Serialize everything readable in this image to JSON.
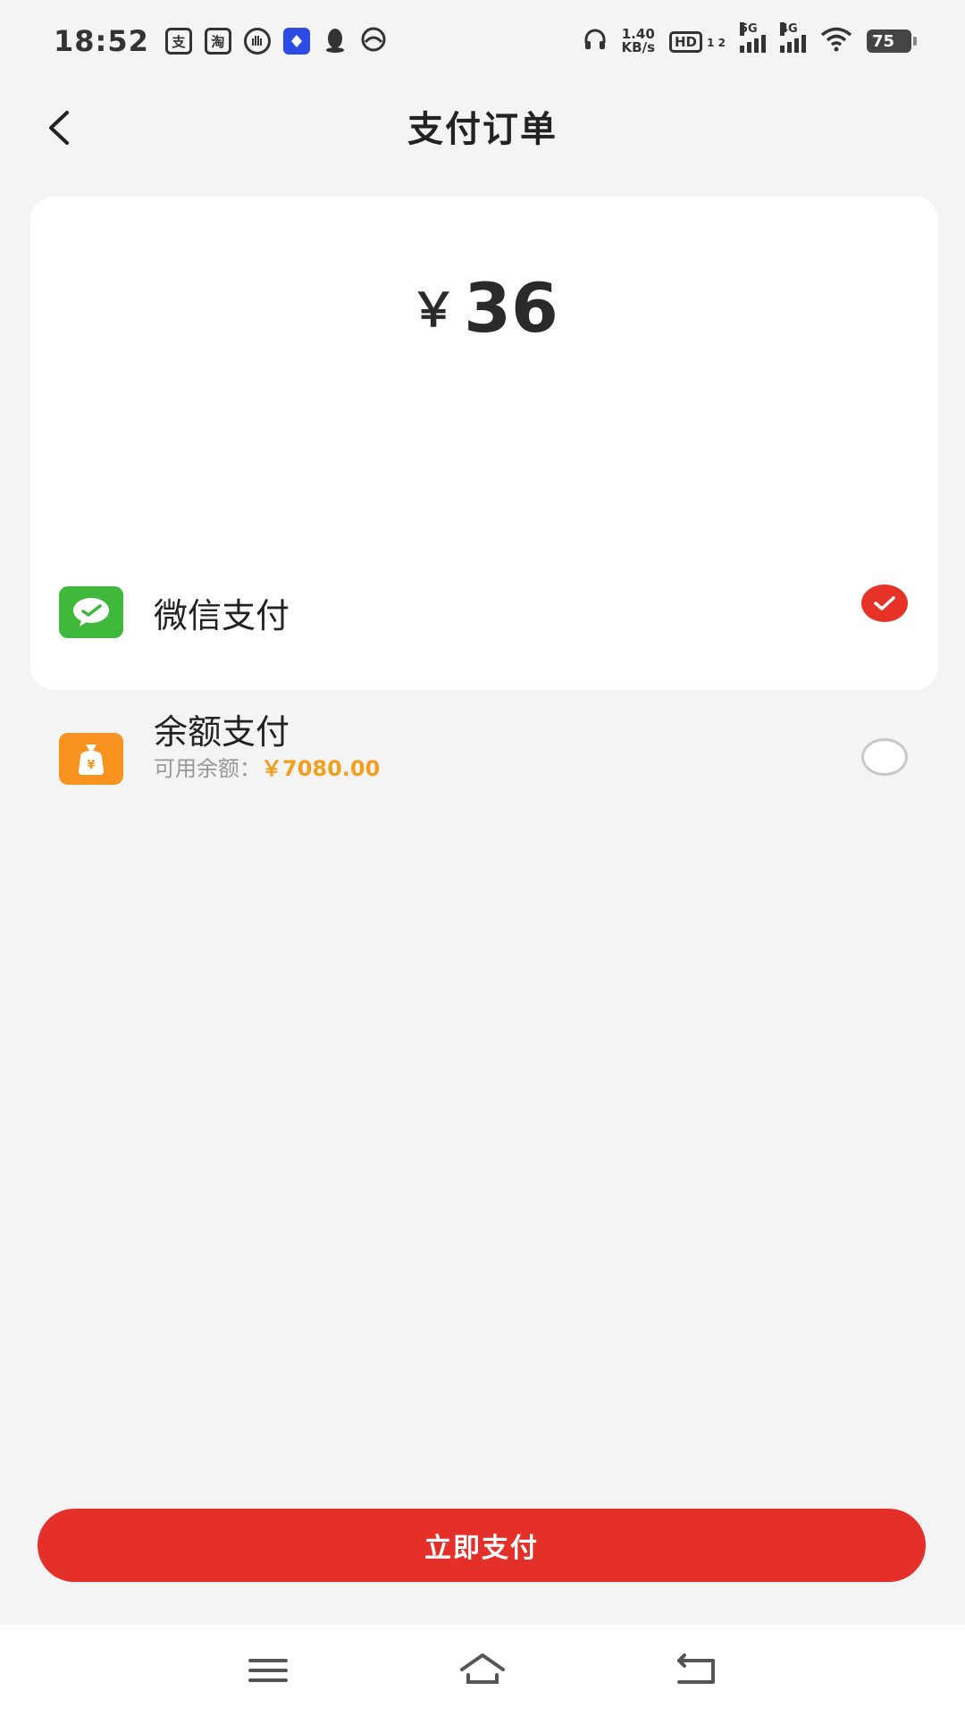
{
  "status_bar": {
    "time": "18:52",
    "app_icons": [
      "支",
      "淘"
    ],
    "net_speed_value": "1.40",
    "net_speed_unit": "KB/s",
    "hd_label": "HD",
    "hd_sub": "1 2",
    "sig1_label": "5G",
    "sig2_label": "4G",
    "battery": "75"
  },
  "header": {
    "title": "支付订单"
  },
  "amount": {
    "symbol": "￥",
    "value": "36"
  },
  "payment_options": [
    {
      "label": "微信支付",
      "icon": "wechat-pay-icon",
      "selected": true
    },
    {
      "label": "余额支付",
      "icon": "money-bag-icon",
      "sub_label": "可用余额：",
      "balance": "￥7080.00",
      "selected": false
    }
  ],
  "pay_button": {
    "label": "立即支付"
  },
  "colors": {
    "accent": "#e5302a",
    "wechat_green": "#3fb83b",
    "balance_orange": "#f7931e",
    "balance_text": "#f0a01e"
  },
  "nav": {
    "icons": [
      "menu-icon",
      "home-icon",
      "back-icon"
    ]
  }
}
